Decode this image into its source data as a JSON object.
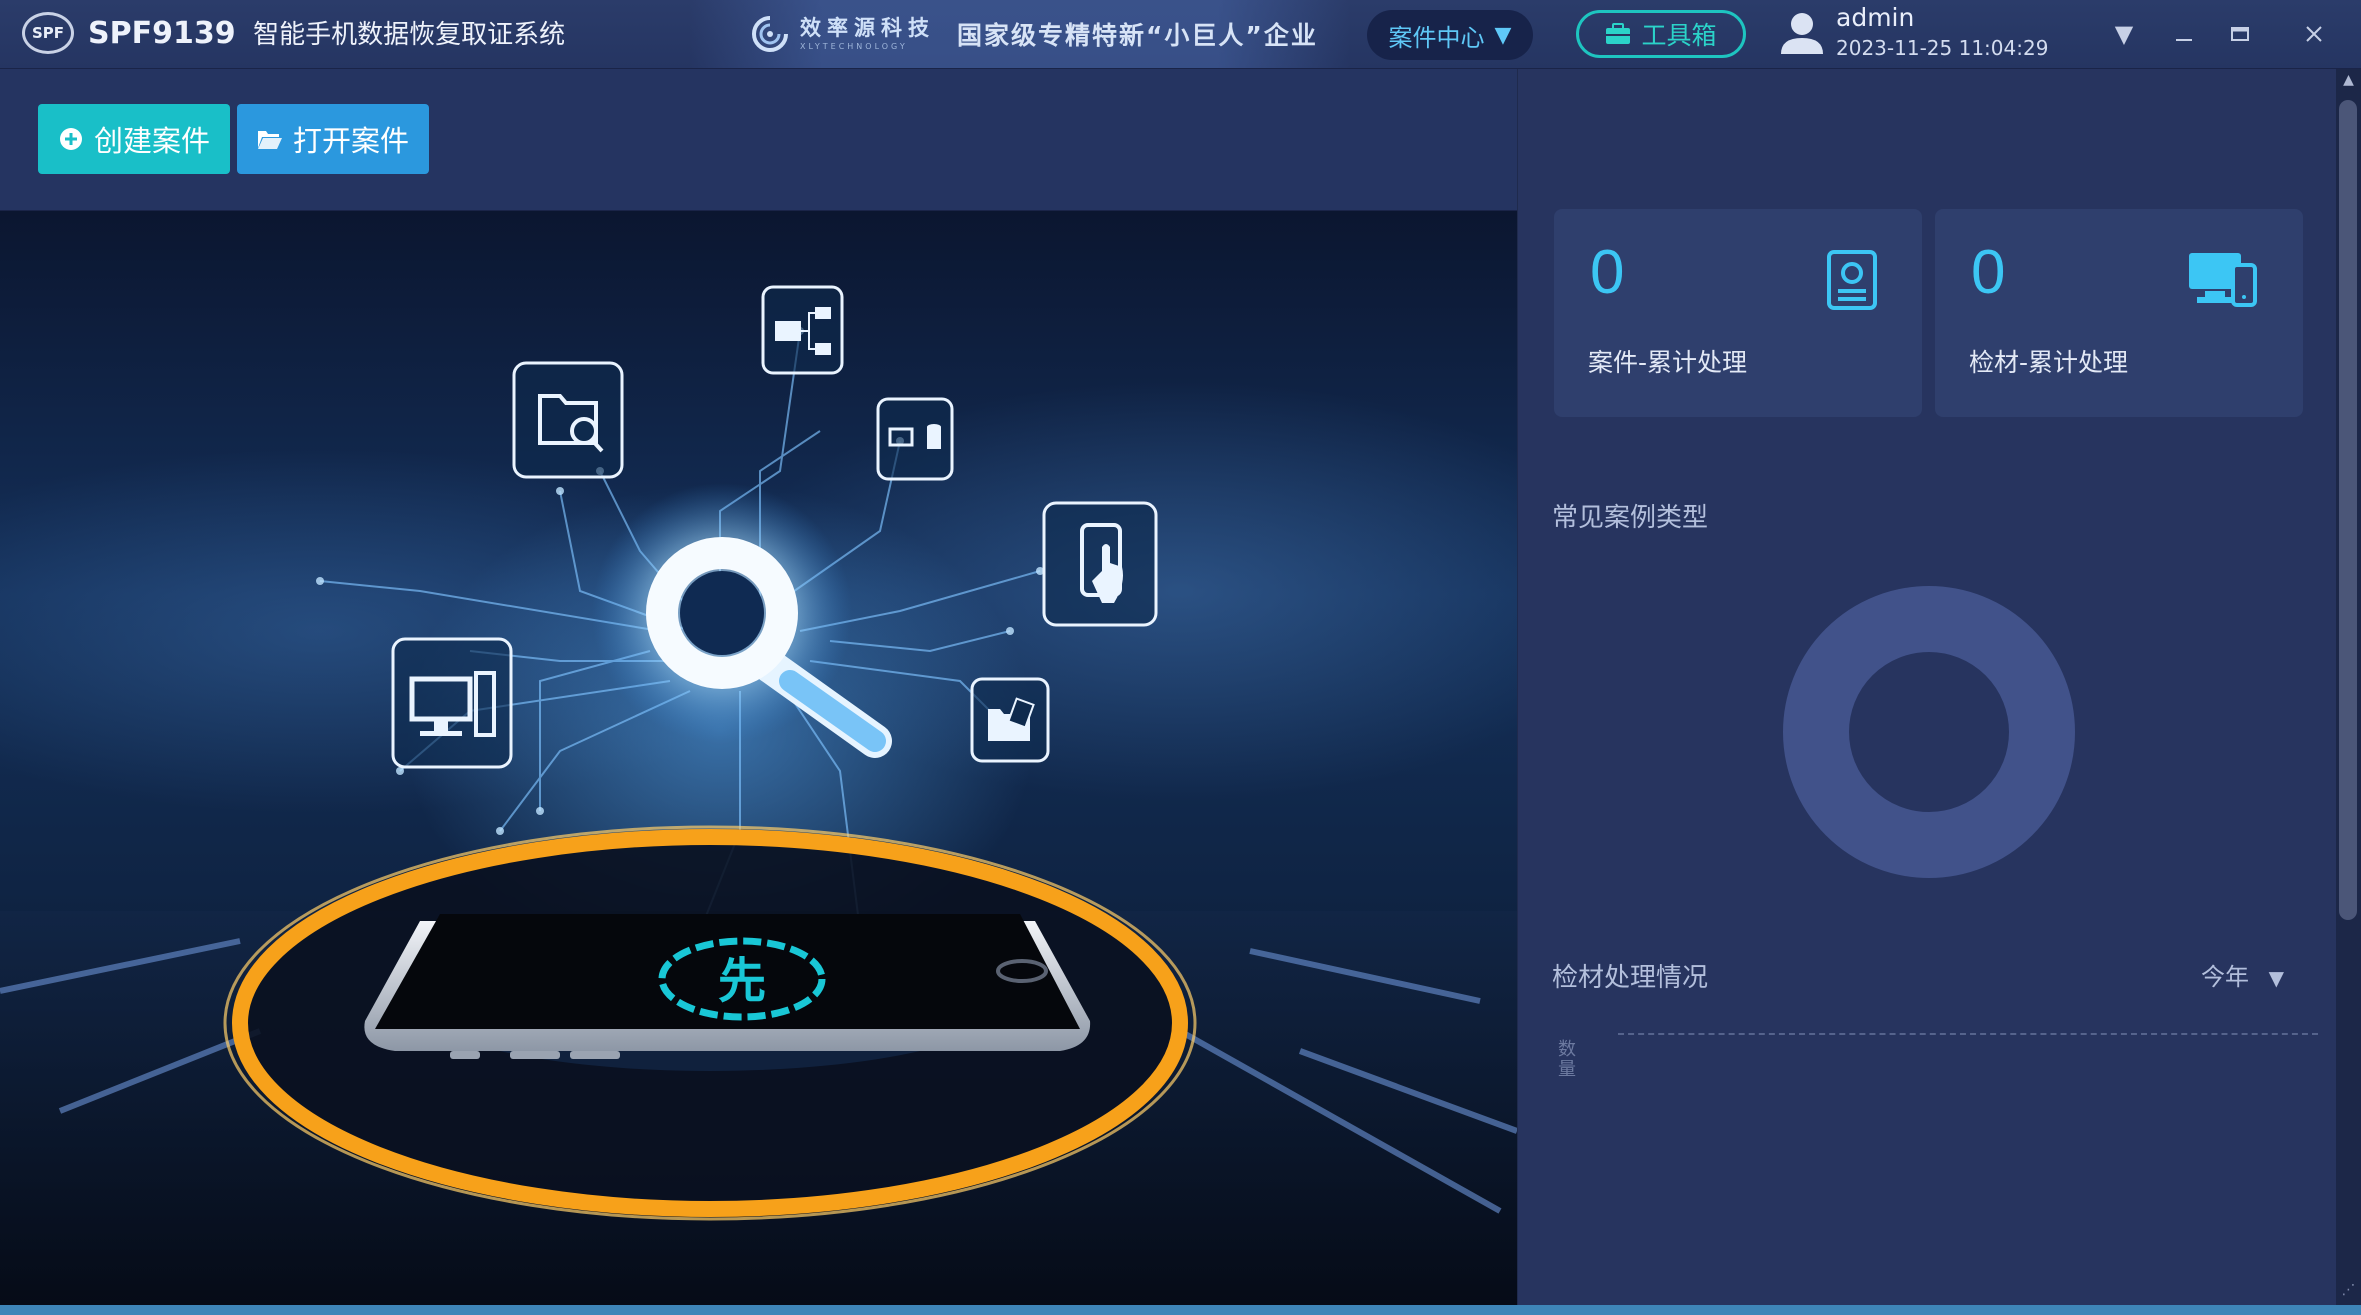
{
  "titlebar": {
    "logo_text": "SPF",
    "product_code": "SPF9139",
    "product_name": "智能手机数据恢复取证系统",
    "banner_company_cn": "效率源科技",
    "banner_company_en": "XLYTECHNOLOGY",
    "banner_slogan": "国家级专精特新“小巨人”企业",
    "case_center_label": "案件中心",
    "toolbox_label": "工具箱",
    "user_name": "admin",
    "datetime": "2023-11-25 11:04:29",
    "window_controls": [
      "dropdown-arrow-icon",
      "minimize-icon",
      "maximize-icon",
      "close-icon"
    ]
  },
  "actions": {
    "create_case": "创建案件",
    "open_case": "打开案件"
  },
  "hero": {
    "phone_screen_logo": "先",
    "icons": [
      "folder-search-icon",
      "folder-tree-icon",
      "computer-database-icon",
      "phone-touch-icon",
      "desktop-computer-icon",
      "folder-files-icon",
      "magnifier-icon"
    ]
  },
  "stats": [
    {
      "value": "0",
      "label": "案件-累计处理",
      "icon": "id-card-icon"
    },
    {
      "value": "0",
      "label": "检材-累计处理",
      "icon": "devices-icon"
    }
  ],
  "sections": {
    "case_types_title": "常见案例类型",
    "material_title": "检材处理情况",
    "period_selected": "今年",
    "y_axis_label": "数量"
  },
  "colors": {
    "accent_teal": "#19bfc8",
    "accent_blue": "#2b98de",
    "stat_value": "#3cc6f4",
    "panel_bg": "#27345f",
    "card_bg": "#2f3f6d",
    "donut": "#41528a"
  }
}
